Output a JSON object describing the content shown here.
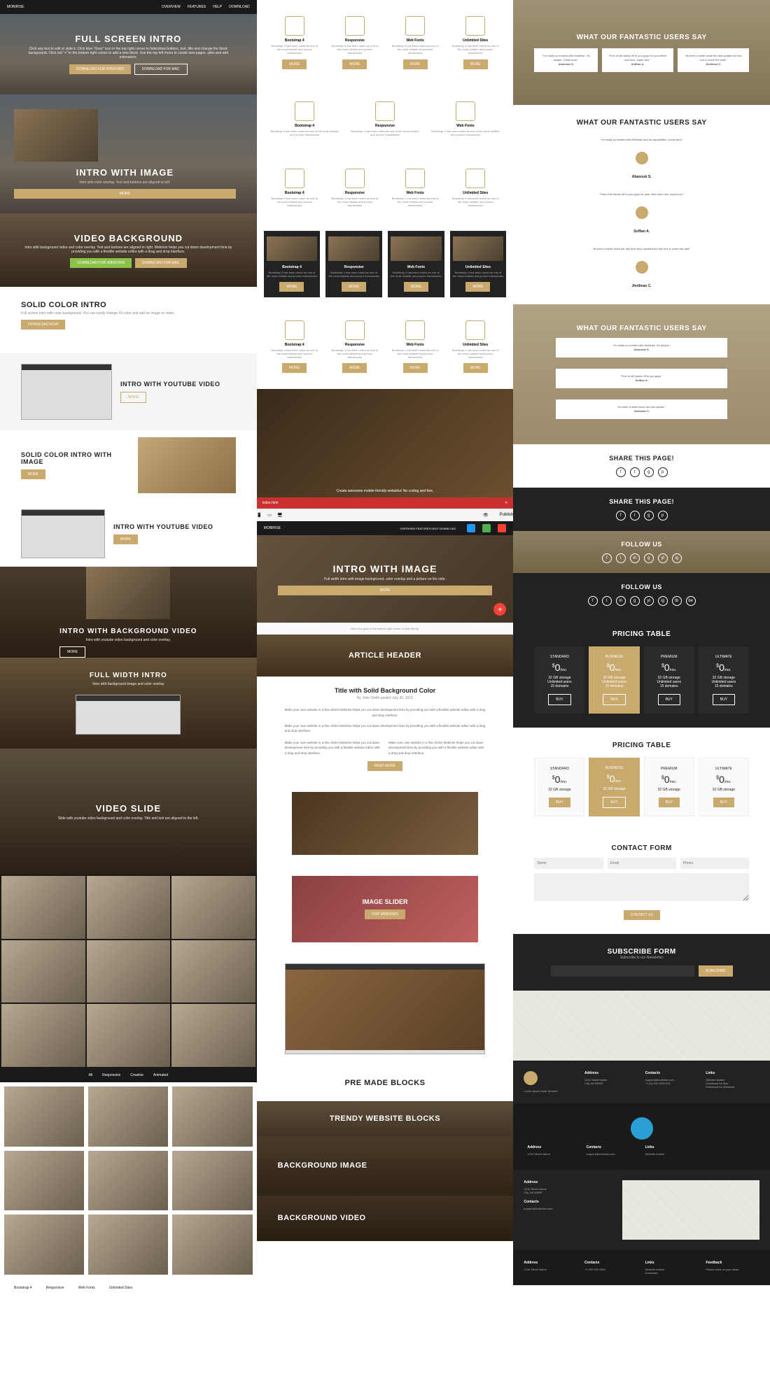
{
  "col1": {
    "nav": {
      "brand": "MOBIRISE",
      "items": [
        "OVERVIEW",
        "FEATURES",
        "HELP",
        "DOWNLOAD"
      ]
    },
    "hero1": {
      "title": "FULL SCREEN INTRO",
      "sub": "Click any text to edit or style it. Click blue \"Gear\" icon in the top right corner to hide/show buttons, text, title and change the block background. Click red \"+\" in the bottom right corner to add a new block. Use the top left menu to create new pages, sites and add extensions.",
      "btn1": "DOWNLOAD FOR WINDOWS",
      "btn2": "DOWNLOAD FOR MAC"
    },
    "intro_img": {
      "title": "INTRO WITH IMAGE",
      "sub": "Intro with color overlay. Text and buttons are aligned to left.",
      "btn": "MORE"
    },
    "video_bg": {
      "title": "VIDEO BACKGROUND",
      "sub": "Intro with background video and color overlay. Text and buttons are aligned to right. Mobirise helps you cut down development time by providing you with a flexible website editor with a drag and drop interface.",
      "btn1": "DOWNLOAD FOR WINDOWS",
      "btn2": "DOWNLOAD FOR MAC"
    },
    "solid": {
      "title": "SOLID COLOR INTRO",
      "sub": "Full screen intro with color background. You can easily change it's color and add an image or video.",
      "btn": "DOWNLOAD NOW"
    },
    "yt1": {
      "title": "INTRO WITH YOUTUBE VIDEO",
      "btn": "MORE"
    },
    "solid_img": {
      "title": "SOLID COLOR INTRO WITH IMAGE",
      "btn": "MORE"
    },
    "yt2": {
      "title": "INTRO WITH YOUTUBE VIDEO",
      "btn": "MORE"
    },
    "bg_video": {
      "title": "INTRO WITH BACKGROUND VIDEO",
      "sub": "Intro with youtube video background and color overlay.",
      "btn": "MORE"
    },
    "fullwidth": {
      "title": "FULL WIDTH INTRO",
      "sub": "Intro with background image and color overlay"
    },
    "slide": {
      "title": "VIDEO SLIDE",
      "sub": "Slide with youtube video background and color overlay. Title and text are aligned to the left."
    },
    "gallery_labels": [
      "Bootstrap 4",
      "Responsive",
      "Web Fonts",
      "Unlimited Sites"
    ]
  },
  "col2": {
    "feat_titles": [
      "Bootstrap 4",
      "Responsive",
      "Web Fonts",
      "Unlimited Sites"
    ],
    "feat_desc": "Bootstrap 4 has been noted as one of the most reliable and proven frameworks",
    "btn": "MORE",
    "big_img": {
      "caption": "Create awesome mobile-friendly websites! No coding and free."
    },
    "editor": {
      "title": "INTRO WITH IMAGE",
      "sub": "Full width intro with image background, color overlay and a picture on the side.",
      "btn": "MORE",
      "tip": "Click blue gear in the bottom right corner to hide this tip."
    },
    "article": {
      "header": "ARTICLE HEADER",
      "title": "Title with Solid Background Color",
      "meta": "By John Smith posted July 30, 2016",
      "body": "Make your own website in a few clicks! Mobirise helps you cut down development time by providing you with a flexible website editor with a drag and drop interface."
    },
    "slider": {
      "label": "IMAGE SLIDER",
      "btn": "FOR WINDOWS"
    },
    "premade": "PRE MADE BLOCKS",
    "trendy": "TRENDY WEBSITE BLOCKS",
    "bgimg": "BACKGROUND IMAGE",
    "bgvid": "BACKGROUND VIDEO"
  },
  "col3": {
    "testi_title": "WHAT OUR FANTASTIC USERS SAY",
    "testi": [
      "Abanoub S.",
      "Suffian A.",
      "Jhollman C."
    ],
    "share": "SHARE THIS PAGE!",
    "follow": "FOLLOW US",
    "pricing": {
      "title": "PRICING TABLE",
      "plans": [
        "STANDARD",
        "BUSINESS",
        "PREMIUM",
        "ULTIMATE"
      ],
      "price": "0",
      "per": "/mo.",
      "feat": [
        "32 GB storage",
        "Unlimited users",
        "15 domains"
      ],
      "btn": "BUY"
    },
    "contact": {
      "title": "CONTACT FORM",
      "fields": [
        "Name",
        "Email",
        "Phone"
      ],
      "btn": "CONTACT US"
    },
    "subscribe": {
      "title": "SUBSCRIBE FORM",
      "sub": "Subscribe to our Newsletter",
      "btn": "SUBSCRIBE"
    },
    "footer": {
      "addr": "Address",
      "phone": "Contacts",
      "links": "Links"
    }
  }
}
